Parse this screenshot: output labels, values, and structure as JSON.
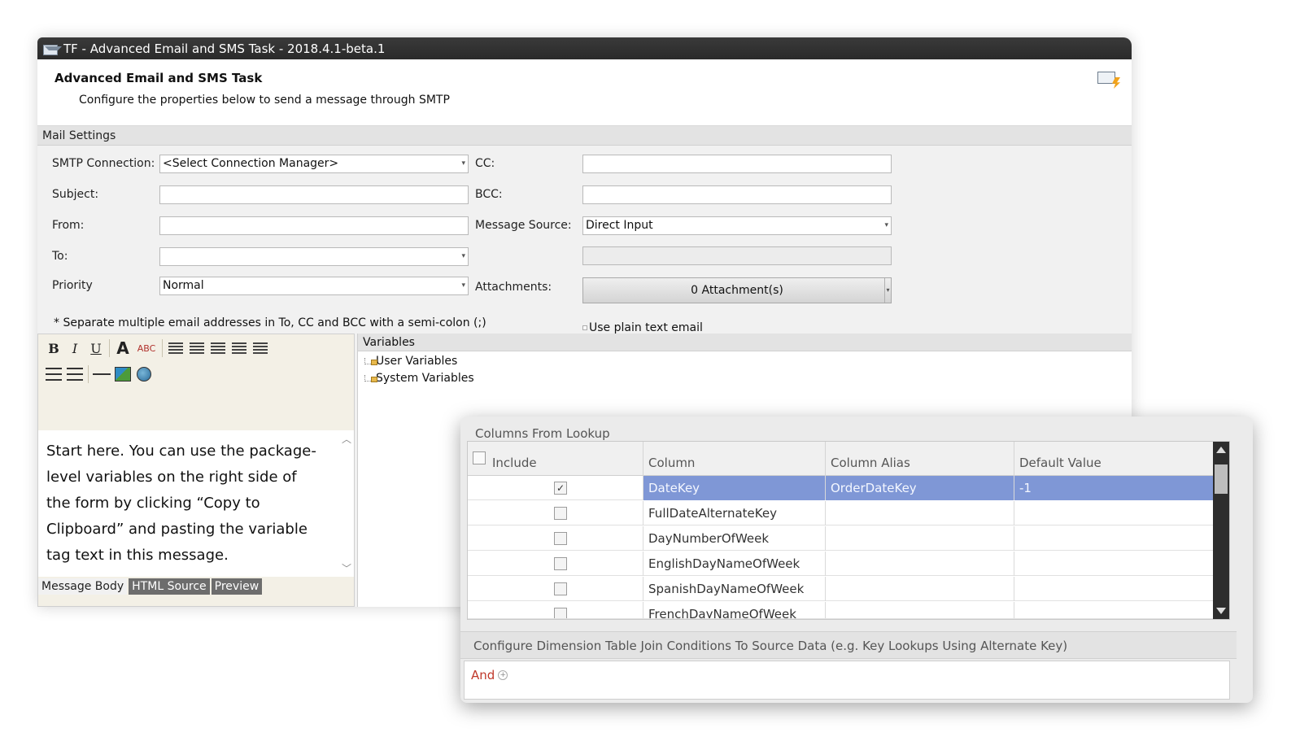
{
  "window": {
    "title": "TF - Advanced Email and SMS Task - 2018.4.1-beta.1",
    "header_title": "Advanced Email and SMS Task",
    "header_subtitle": "Configure the properties below to send a message through SMTP"
  },
  "mail_settings": {
    "section_label": "Mail Settings",
    "smtp_label": "SMTP Connection:",
    "smtp_value": "<Select Connection Manager>",
    "subject_label": "Subject:",
    "subject_value": "",
    "from_label": "From:",
    "from_value": "",
    "to_label": "To:",
    "to_value": "",
    "priority_label": "Priority",
    "priority_value": "Normal",
    "cc_label": "CC:",
    "cc_value": "",
    "bcc_label": "BCC:",
    "bcc_value": "",
    "message_source_label": "Message Source:",
    "message_source_value": "Direct Input",
    "attachments_label": "Attachments:",
    "attachments_button": "0 Attachment(s)",
    "note": "* Separate multiple email addresses in To, CC and BCC with a semi-colon (;)",
    "plain_text_label": "Use plain text email"
  },
  "editor": {
    "toolbar": {
      "bold": "B",
      "italic": "I",
      "underline": "U",
      "font_color": "A",
      "spellcheck": "ABC"
    },
    "body_text": "Start here. You can use the package-level variables on the right side of the form by clicking “Copy to Clipboard” and pasting the variable tag text in this message.",
    "tabs": [
      "Message Body",
      "HTML Source",
      "Preview"
    ]
  },
  "variables": {
    "header": "Variables",
    "items": [
      "User Variables",
      "System Variables"
    ]
  },
  "lookup": {
    "title": "Columns From Lookup",
    "columns": [
      "Include",
      "Column",
      "Column Alias",
      "Default Value"
    ],
    "rows": [
      {
        "include": true,
        "column": "DateKey",
        "alias": "OrderDateKey",
        "default": "-1"
      },
      {
        "include": false,
        "column": "FullDateAlternateKey",
        "alias": "",
        "default": ""
      },
      {
        "include": false,
        "column": "DayNumberOfWeek",
        "alias": "",
        "default": ""
      },
      {
        "include": false,
        "column": "EnglishDayNameOfWeek",
        "alias": "",
        "default": ""
      },
      {
        "include": false,
        "column": "SpanishDayNameOfWeek",
        "alias": "",
        "default": ""
      },
      {
        "include": false,
        "column": "FrenchDayNameOfWeek",
        "alias": "",
        "default": ""
      }
    ],
    "selected_row_color": "#7f97d6",
    "join_title": "Configure Dimension Table Join Conditions To Source Data (e.g. Key Lookups Using Alternate Key)",
    "and_label": "And"
  }
}
